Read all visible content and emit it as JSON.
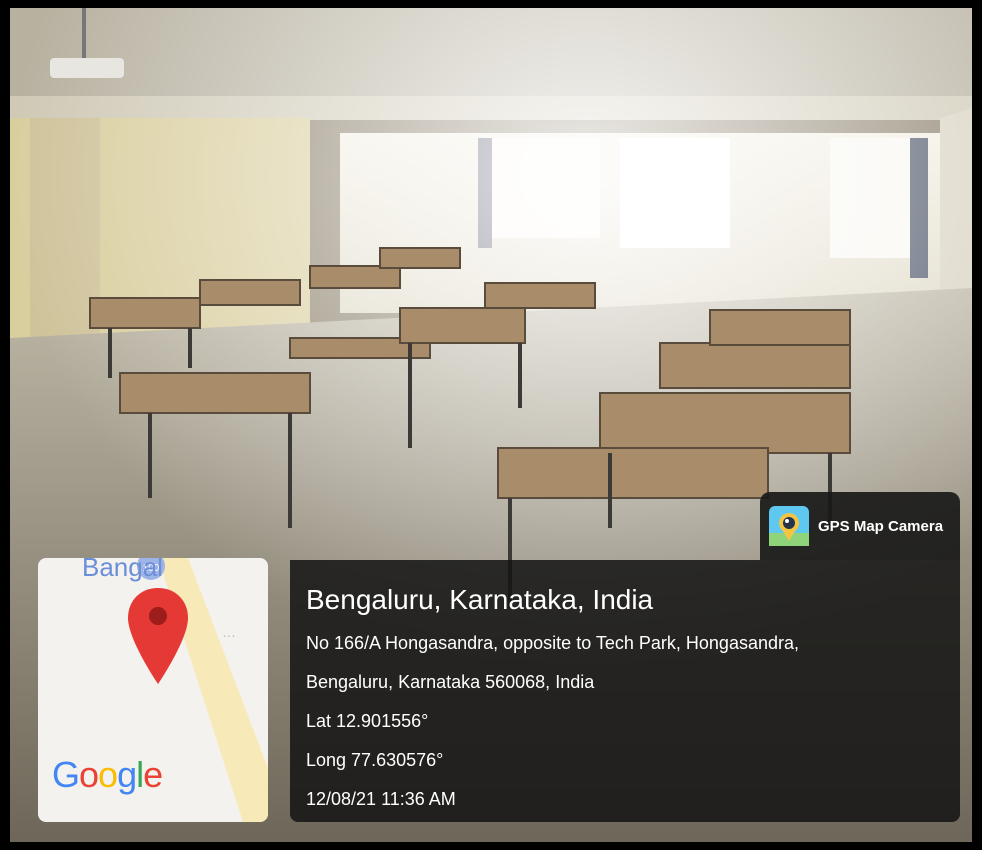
{
  "app": {
    "name": "GPS Map Camera",
    "icon": "camera-pin-icon"
  },
  "location": {
    "city": "Bengaluru, Karnataka, India",
    "address_line1": "No 166/A Hongasandra, opposite to Tech Park, Hongasandra,",
    "address_line2": "Bengaluru, Karnataka 560068, India",
    "latitude": "Lat 12.901556°",
    "longitude": "Long 77.630576°",
    "timestamp": "12/08/21 11:36 AM"
  },
  "map": {
    "place_label": "Bangal",
    "route_badge": "100",
    "provider_logo": [
      "G",
      "o",
      "o",
      "g",
      "l",
      "e"
    ],
    "pin_icon": "map-pin-icon",
    "colors": {
      "pin": "#e53935",
      "logo": [
        "#4285F4",
        "#EA4335",
        "#FBBC05",
        "#4285F4",
        "#34A853",
        "#EA4335"
      ]
    }
  },
  "scene": {
    "description_icon": "classroom-photo"
  }
}
